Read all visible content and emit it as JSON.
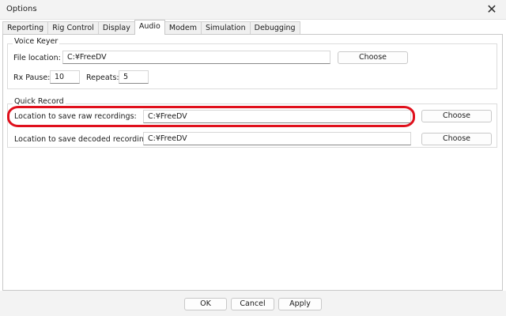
{
  "window": {
    "title": "Options",
    "close_glyph": "✕"
  },
  "tabs": [
    {
      "label": "Reporting"
    },
    {
      "label": "Rig Control"
    },
    {
      "label": "Display"
    },
    {
      "label": "Audio",
      "active": true
    },
    {
      "label": "Modem"
    },
    {
      "label": "Simulation"
    },
    {
      "label": "Debugging"
    }
  ],
  "voice_keyer": {
    "title": "Voice Keyer",
    "file_location_label": "File location:",
    "file_location_value": "C:¥FreeDV",
    "choose_label": "Choose",
    "rx_pause_label": "Rx Pause:",
    "rx_pause_value": "10",
    "repeats_label": "Repeats:",
    "repeats_value": "5"
  },
  "quick_record": {
    "title": "Quick Record",
    "raw_label": "Location to save raw recordings:",
    "raw_value": "C:¥FreeDV",
    "raw_choose_label": "Choose",
    "decoded_label": "Location to save decoded recordings:",
    "decoded_value": "C:¥FreeDV",
    "decoded_choose_label": "Choose"
  },
  "footer": {
    "ok_label": "OK",
    "cancel_label": "Cancel",
    "apply_label": "Apply"
  },
  "colors": {
    "highlight": "#e0101c",
    "background": "#ffffff",
    "chrome": "#f3f3f3"
  }
}
